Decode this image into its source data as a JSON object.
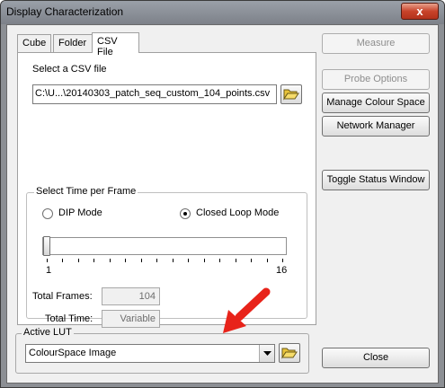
{
  "window": {
    "title": "Display Characterization",
    "close_glyph": "x"
  },
  "tabs": [
    {
      "label": "Cube",
      "active": false
    },
    {
      "label": "Folder",
      "active": false
    },
    {
      "label": "CSV File",
      "active": true
    }
  ],
  "csv": {
    "select_label": "Select a CSV file",
    "path_value": "C:\\U...\\20140303_patch_seq_custom_104_points.csv"
  },
  "time_per_frame": {
    "group_title": "Select Time per Frame",
    "dip_mode_label": "DIP Mode",
    "closed_loop_label": "Closed Loop Mode",
    "selected_mode": "closed_loop",
    "slider": {
      "min": 1,
      "max": 16,
      "value": 1,
      "min_label": "1",
      "max_label": "16"
    },
    "total_frames_label": "Total Frames:",
    "total_frames_value": "104",
    "total_time_label": "Total Time:",
    "total_time_value": "Variable"
  },
  "active_lut": {
    "group_title": "Active LUT",
    "selected_value": "ColourSpace Image"
  },
  "buttons": {
    "measure": "Measure",
    "probe_options": "Probe Options",
    "manage_colour_space": "Manage Colour Space",
    "network_manager": "Network Manager",
    "toggle_status_window": "Toggle Status Window",
    "close": "Close"
  },
  "annotation": {
    "arrow_color": "#e8231a"
  },
  "icons": {
    "folder": "folder-open-icon",
    "dropdown": "chevron-down-icon"
  }
}
